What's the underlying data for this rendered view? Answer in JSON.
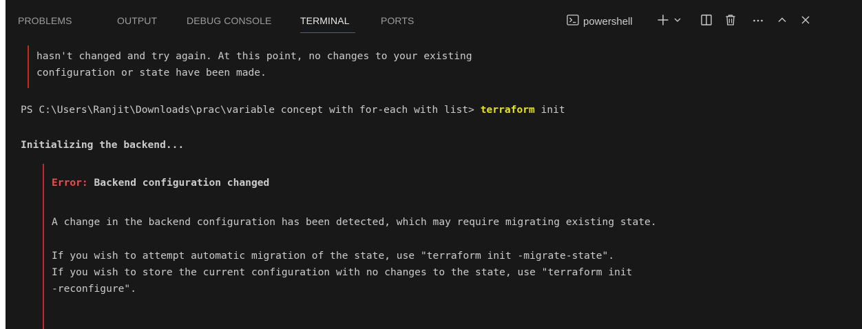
{
  "tabs": [
    {
      "label": "PROBLEMS",
      "active": false
    },
    {
      "label": "OUTPUT",
      "active": false
    },
    {
      "label": "DEBUG CONSOLE",
      "active": false
    },
    {
      "label": "TERMINAL",
      "active": true
    },
    {
      "label": "PORTS",
      "active": false
    }
  ],
  "toolbar": {
    "shell_name": "powershell",
    "icons": [
      "terminal-icon",
      "plus-icon",
      "chevron-down-icon",
      "split-icon",
      "trash-icon",
      "ellipsis-icon",
      "chevron-up-icon",
      "close-icon"
    ]
  },
  "terminal": {
    "prev_error_line1": "hasn't changed and try again. At this point, no changes to your existing",
    "prev_error_line2": "configuration or state have been made.",
    "prompt": "PS C:\\Users\\Ranjit\\Downloads\\prac\\variable concept with for-each with list> ",
    "command": "terraform",
    "command_args": " init",
    "init_backend": "Initializing the backend...",
    "error_label": "Error:",
    "error_title": " Backend configuration changed",
    "msg_line1": "A change in the backend configuration has been detected, which may require migrating existing state.",
    "msg_line2": "If you wish to attempt automatic migration of the state, use \"terraform init -migrate-state\".",
    "msg_line3": "If you wish to store the current configuration with no changes to the state, use \"terraform init",
    "msg_line4": "-reconfigure\"."
  },
  "colors": {
    "background": "#181818",
    "text": "#cccccc",
    "command": "#e5e510",
    "error": "#f14c4c",
    "error_bar": "#c62828",
    "active_tab_underline": "#0078d4"
  }
}
